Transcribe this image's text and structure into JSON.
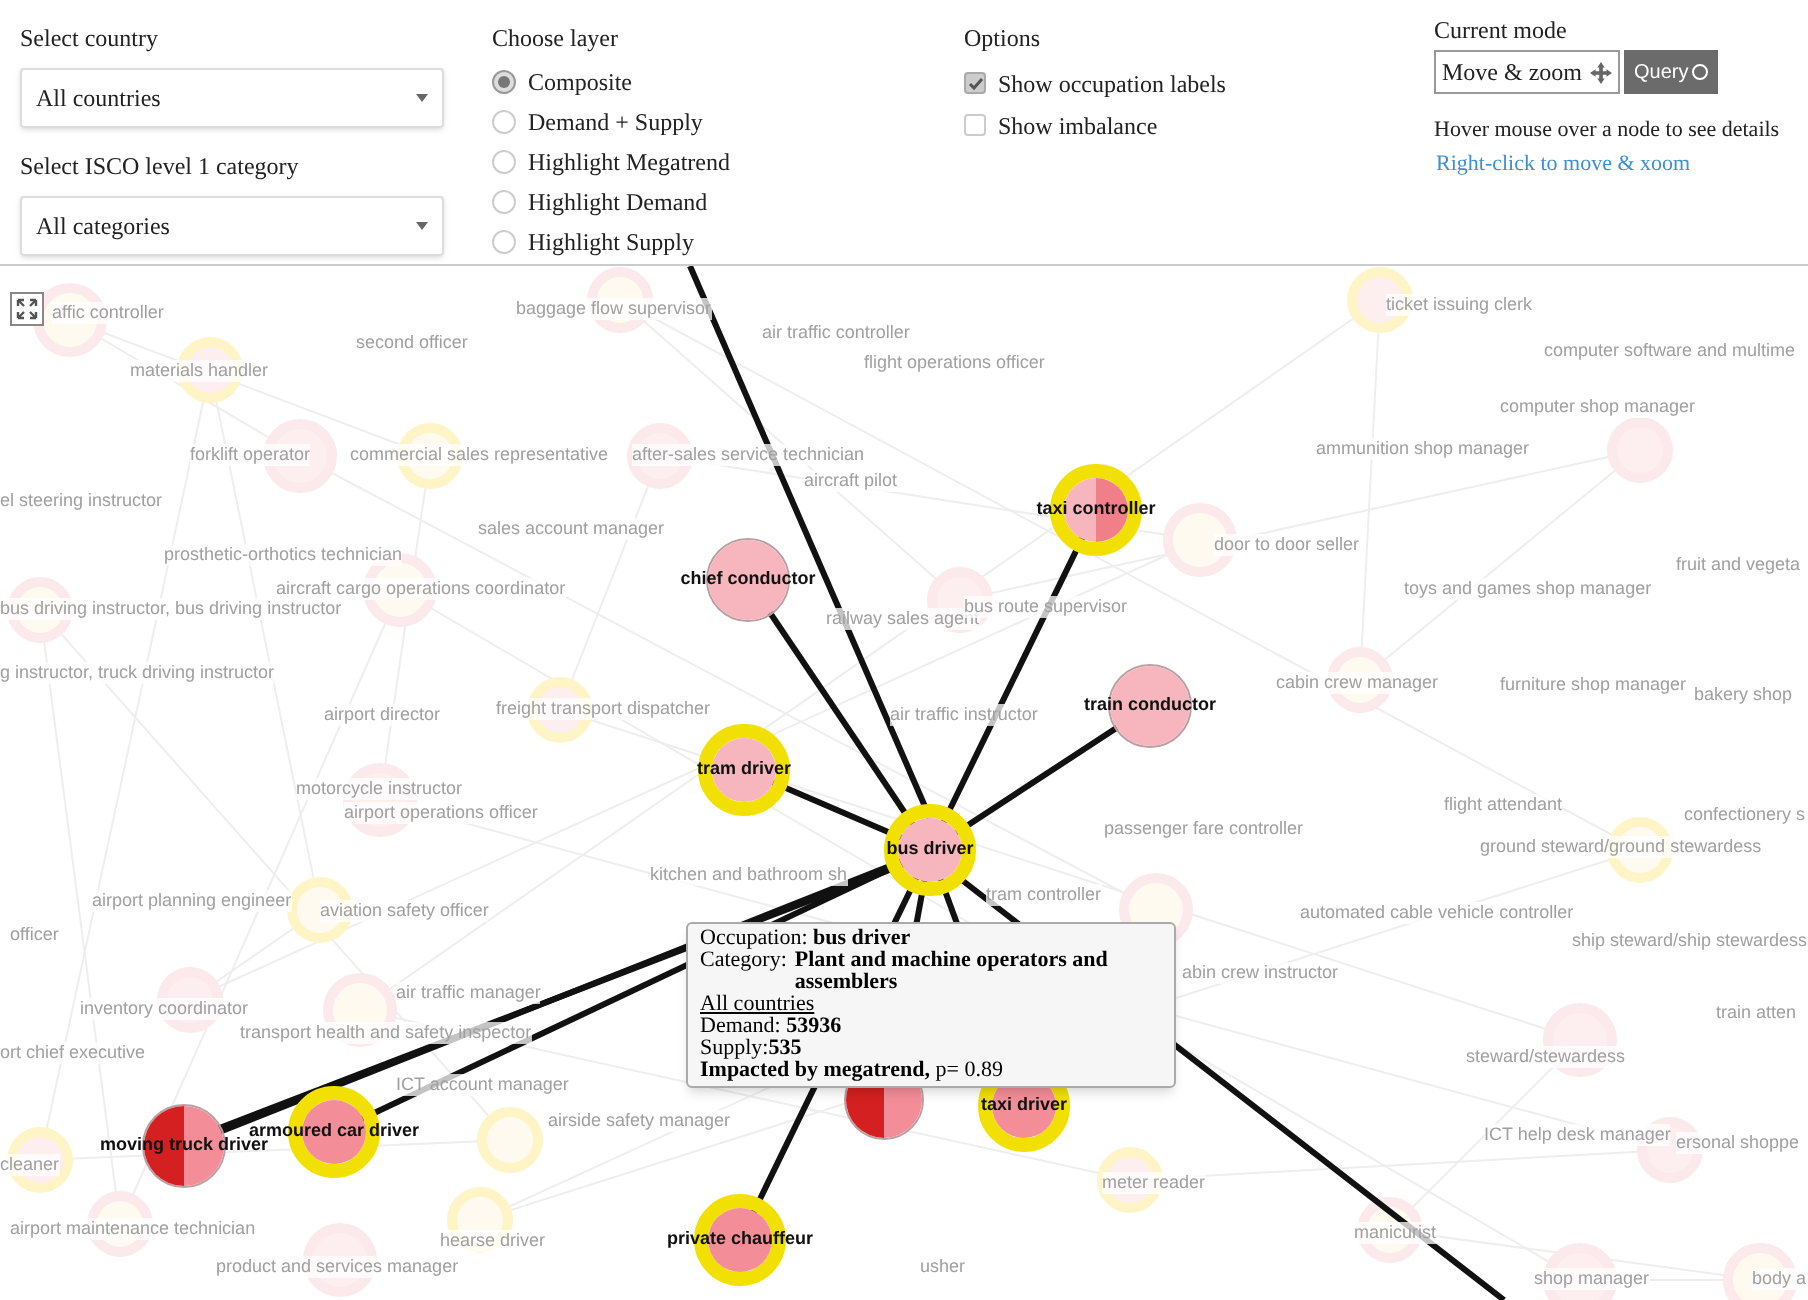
{
  "country": {
    "label": "Select country",
    "value": "All countries"
  },
  "category": {
    "label": "Select ISCO level 1 category",
    "value": "All categories"
  },
  "layer": {
    "title": "Choose layer",
    "options": [
      {
        "label": "Composite",
        "selected": true
      },
      {
        "label": "Demand + Supply",
        "selected": false
      },
      {
        "label": "Highlight Megatrend",
        "selected": false
      },
      {
        "label": "Highlight Demand",
        "selected": false
      },
      {
        "label": "Highlight Supply",
        "selected": false
      }
    ]
  },
  "options": {
    "title": "Options",
    "checkboxes": [
      {
        "label": "Show occupation labels",
        "checked": true
      },
      {
        "label": "Show imbalance",
        "checked": false
      }
    ]
  },
  "mode": {
    "title": "Current mode",
    "value": "Move & zoom",
    "button": "Query",
    "hint": "Hover mouse over a node to see details",
    "link": "Right-click to move & xoom"
  },
  "background_labels": [
    "affic controller",
    "second officer",
    "baggage flow supervisor",
    "materials handler",
    "air traffic controller",
    "flight operations officer",
    "forklift operator",
    "commercial sales representative",
    "after-sales service technician",
    "aircraft pilot",
    "el steering instructor",
    "sales account manager",
    "prosthetic-orthotics technician",
    "aircraft cargo operations coordinator",
    "bus driving instructor, bus driving instructor",
    "g instructor, truck driving instructor",
    "airport director",
    "freight transport dispatcher",
    "railway sales agent",
    "bus route supervisor",
    "air traffic instructor",
    "ticket issuing clerk",
    "computer software and multime",
    "computer shop manager",
    "ammunition shop manager",
    "door to door seller",
    "toys and games shop manager",
    "fruit and vegeta",
    "cabin crew manager",
    "furniture shop manager",
    "bakery shop",
    "motorcycle instructor",
    "airport operations officer",
    "passenger fare controller",
    "flight attendant",
    "confectionery s",
    "ground steward/ground stewardess",
    "kitchen and bathroom sh",
    "tram controller",
    "airport planning engineer",
    "aviation safety officer",
    "officer",
    "automated cable vehicle controller",
    "ship steward/ship stewardess",
    "abin crew instructor",
    "air traffic manager",
    "inventory coordinator",
    "transport health and safety inspector",
    "train atten",
    "ort chief executive",
    "steward/stewardess",
    "ICT account manager",
    "airside safety manager",
    "ICT help desk manager",
    "ersonal shoppe",
    "cleaner",
    "meter reader",
    "airport maintenance technician",
    "hearse driver",
    "product and services manager",
    "usher",
    "manicurist",
    "shop manager",
    "body a"
  ],
  "nodes": [
    {
      "label": "bus driver",
      "ring": true,
      "segments": [
        {
          "color": "#f7b6bd"
        }
      ]
    },
    {
      "label": "chief conductor",
      "ring": false,
      "segments": [
        {
          "color": "#f7b6bd"
        }
      ]
    },
    {
      "label": "taxi controller",
      "ring": true,
      "segments": [
        {
          "color": "#f7b6bd"
        },
        {
          "color": "#f07f8a"
        }
      ]
    },
    {
      "label": "train conductor",
      "ring": false,
      "segments": [
        {
          "color": "#f7b6bd"
        }
      ]
    },
    {
      "label": "tram driver",
      "ring": true,
      "segments": [
        {
          "color": "#f7b6bd"
        }
      ]
    },
    {
      "label": "armoured car driver",
      "ring": true,
      "segments": [
        {
          "color": "#f38e98"
        }
      ]
    },
    {
      "label": "moving truck driver",
      "ring": false,
      "segments": [
        {
          "color": "#d42020"
        },
        {
          "color": "#f38e98"
        }
      ]
    },
    {
      "label": "private chauffeur",
      "ring": true,
      "segments": [
        {
          "color": "#f38e98"
        }
      ]
    },
    {
      "label": "taxi driver",
      "ring": true,
      "segments": [
        {
          "color": "#f38e98"
        }
      ]
    },
    {
      "ring": false,
      "segments": [
        {
          "color": "#d42020"
        },
        {
          "color": "#f38e98"
        }
      ]
    }
  ],
  "tooltip": {
    "lines": [
      {
        "kind": "text",
        "text": "Occupation: **bus driver**"
      },
      {
        "kind": "pair",
        "label": "Category:",
        "value": "Plant and machine operators and assemblers"
      },
      {
        "kind": "link",
        "text": "All countries"
      },
      {
        "kind": "text",
        "text": "Demand: **53936**"
      },
      {
        "kind": "text",
        "text": "Supply:**535**"
      },
      {
        "kind": "text",
        "text": "**Impacted by megatrend,** p= 0.89"
      }
    ]
  }
}
